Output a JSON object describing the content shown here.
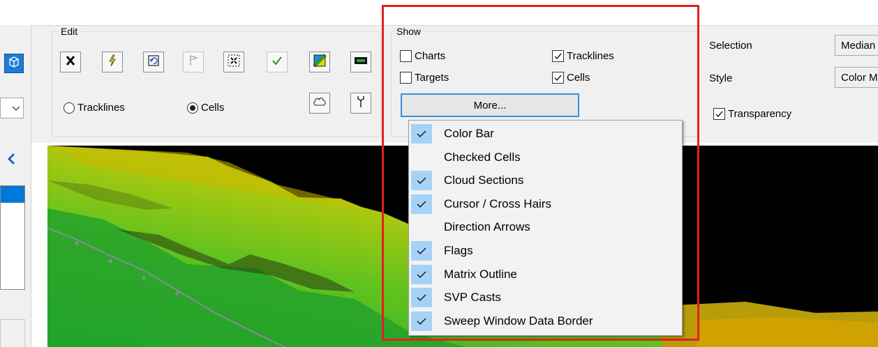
{
  "edit": {
    "title": "Edit",
    "radios": [
      {
        "label": "Tracklines",
        "selected": false
      },
      {
        "label": "Cells",
        "selected": true
      }
    ]
  },
  "show": {
    "title": "Show",
    "checks": [
      {
        "label": "Charts",
        "checked": false
      },
      {
        "label": "Tracklines",
        "checked": true
      },
      {
        "label": "Targets",
        "checked": false
      },
      {
        "label": "Cells",
        "checked": true
      }
    ],
    "more_label": "More..."
  },
  "right": {
    "selection_label": "Selection",
    "selection_value": "Median",
    "style_label": "Style",
    "style_value": "Color M",
    "transparency_label": "Transparency",
    "transparency_checked": true
  },
  "menu": {
    "items": [
      {
        "label": "Color Bar",
        "checked": true
      },
      {
        "label": "Checked Cells",
        "checked": false
      },
      {
        "label": "Cloud Sections",
        "checked": true
      },
      {
        "label": "Cursor / Cross Hairs",
        "checked": true
      },
      {
        "label": "Direction Arrows",
        "checked": false
      },
      {
        "label": "Flags",
        "checked": true
      },
      {
        "label": "Matrix Outline",
        "checked": true
      },
      {
        "label": "SVP Casts",
        "checked": true
      },
      {
        "label": "Sweep Window Data Border",
        "checked": true
      }
    ]
  },
  "colors": {
    "highlight": "#a6d2f7",
    "focus_border": "#3c8fd6",
    "annotation_red": "#e31e24"
  }
}
